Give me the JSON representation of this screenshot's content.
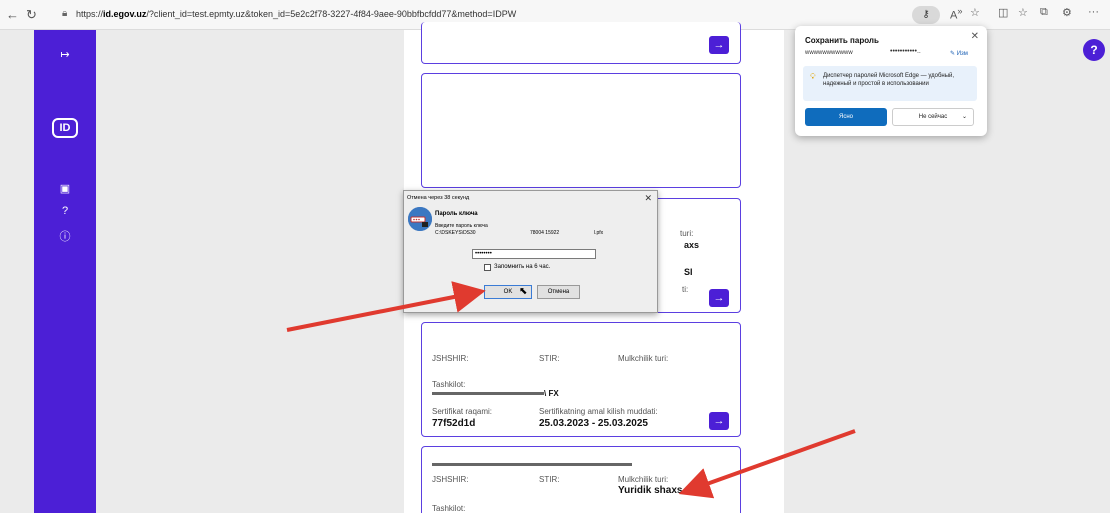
{
  "browser": {
    "url_prefix": "https://",
    "url_domain": "id.egov.uz",
    "url_rest": "/?client_id=test.epmty.uz&token_id=5e2c2f78-3227-4f84-9aee-90bbfbcfdd77&method=IDPW",
    "back_icon": "back-arrow-icon",
    "refresh_icon": "refresh-icon"
  },
  "sidebar": {
    "logo_text": "ID",
    "accent": "#4c1fd6"
  },
  "cards": {
    "card3": {
      "label_jshshir": "JSHSHIR:",
      "label_stir": "STIR:",
      "label_mulk": "Mulkchilik turi:",
      "label_tashkilot": "Tashkilot:",
      "tashkilot_value": "\\ FX",
      "label_sert": "Sertifikat raqami:",
      "sert_value": "77f52d1d",
      "label_muddat": "Sertifikatning amal kilish muddati:",
      "muddat_value": "25.03.2023 - 25.03.2025"
    },
    "card4": {
      "label_jshshir": "JSHSHIR:",
      "label_stir": "STIR:",
      "label_mulk": "Mulkchilik turi:",
      "mulk_value": "Yuridik shaxs",
      "label_tashkilot": "Tashkilot:"
    },
    "card2_partial": {
      "mulk_label_tail": "turi:",
      "mulk_value_tail": "axs",
      "tashkilot_tail": "SI",
      "muddat_tail": "ti:"
    }
  },
  "password_popup": {
    "title": "Сохранить пароль",
    "username": "wwwwwwwwwww",
    "password_mask": "•••••••••••..",
    "edit_label": "Изм",
    "info_text": "Диспетчер паролей Microsoft Edge — удобный, надежный и простой в использовании",
    "yes_label": "Ясно",
    "no_label": "Не сейчас"
  },
  "key_dialog": {
    "title": "Отмена через 38 секунд",
    "heading": "Пароль ключа",
    "subheading": "Введите пароль ключа",
    "path_start": "C:\\DSKEYS\\DS30",
    "path_mid": "78004 15922",
    "path_end": "l.pfx",
    "password_value": "••••••••",
    "remember_label": "Запомнить на 6 час.",
    "ok_label": "OK",
    "cancel_label": "Отмена"
  }
}
